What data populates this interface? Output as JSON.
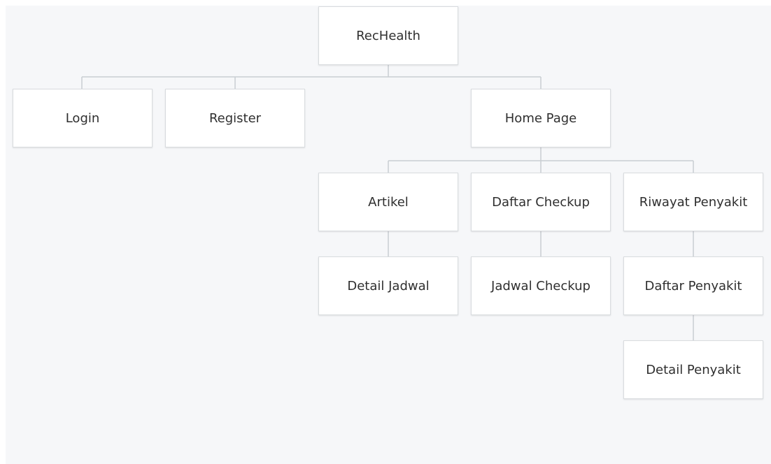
{
  "diagram": {
    "nodes": {
      "root": "RecHealth",
      "login": "Login",
      "register": "Register",
      "home": "Home Page",
      "artikel": "Artikel",
      "daftar_checkup": "Daftar Checkup",
      "riwayat_penyakit": "Riwayat Penyakit",
      "detail_jadwal": "Detail Jadwal",
      "jadwal_checkup": "Jadwal Checkup",
      "daftar_penyakit": "Daftar Penyakit",
      "detail_penyakit": "Detail Penyakit"
    },
    "edges": [
      [
        "root",
        "login"
      ],
      [
        "root",
        "register"
      ],
      [
        "root",
        "home"
      ],
      [
        "home",
        "artikel"
      ],
      [
        "home",
        "daftar_checkup"
      ],
      [
        "home",
        "riwayat_penyakit"
      ],
      [
        "artikel",
        "detail_jadwal"
      ],
      [
        "daftar_checkup",
        "jadwal_checkup"
      ],
      [
        "riwayat_penyakit",
        "daftar_penyakit"
      ],
      [
        "daftar_penyakit",
        "detail_penyakit"
      ]
    ],
    "colors": {
      "background": "#f6f7f9",
      "node_fill": "#ffffff",
      "node_border": "#d9dcdf",
      "connector": "#c9cdd2",
      "text": "#2f2f2f"
    }
  }
}
